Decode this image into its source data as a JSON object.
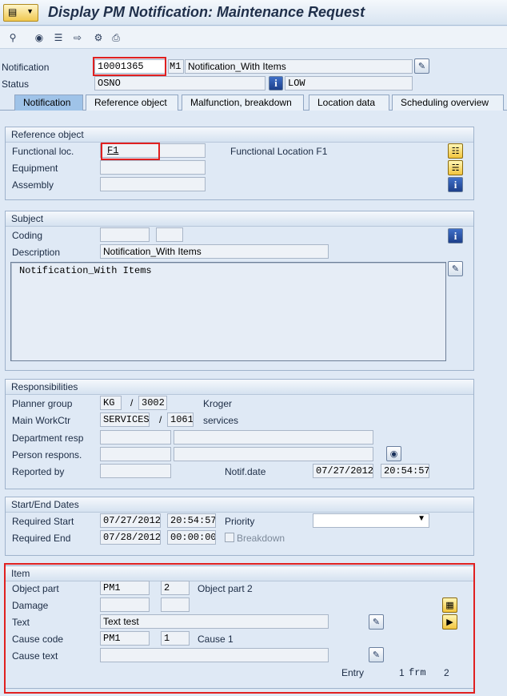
{
  "window": {
    "title": "Display PM Notification: Maintenance Request"
  },
  "header": {
    "notification_label": "Notification",
    "notification_number": "10001365",
    "notification_type": "M1",
    "notification_desc": "Notification_With Items",
    "status_label": "Status",
    "status_value": "OSNO",
    "priority_text": "LOW"
  },
  "tabs": [
    {
      "label": "Notification"
    },
    {
      "label": "Reference object"
    },
    {
      "label": "Malfunction, breakdown"
    },
    {
      "label": "Location data"
    },
    {
      "label": "Scheduling overview"
    }
  ],
  "reference_object": {
    "title": "Reference object",
    "functional_loc_label": "Functional loc.",
    "functional_loc_value": "F1",
    "functional_loc_desc": "Functional Location F1",
    "equipment_label": "Equipment",
    "assembly_label": "Assembly"
  },
  "subject": {
    "title": "Subject",
    "coding_label": "Coding",
    "description_label": "Description",
    "description_value": "Notification_With Items",
    "long_text": "Notification_With Items"
  },
  "responsibilities": {
    "title": "Responsibilities",
    "planner_group_label": "Planner group",
    "planner_group": "KG",
    "planner_plant": "3002",
    "planner_desc": "Kroger",
    "main_workctr_label": "Main WorkCtr",
    "main_workctr": "SERVICES",
    "workctr_plant": "1061",
    "workctr_desc": "services",
    "department_label": "Department resp",
    "person_label": "Person respons.",
    "reported_by_label": "Reported by",
    "notif_date_label": "Notif.date",
    "notif_date": "07/27/2012",
    "notif_time": "20:54:57"
  },
  "dates": {
    "title": "Start/End Dates",
    "required_start_label": "Required Start",
    "start_date": "07/27/2012",
    "start_time": "20:54:57",
    "required_end_label": "Required End",
    "end_date": "07/28/2012",
    "end_time": "00:00:00",
    "priority_label": "Priority",
    "breakdown_label": "Breakdown"
  },
  "item": {
    "title": "Item",
    "object_part_label": "Object part",
    "object_part": "PM1",
    "object_part_code": "2",
    "object_part_desc": "Object part 2",
    "damage_label": "Damage",
    "text_label": "Text",
    "text_value": "Text test",
    "cause_code_label": "Cause code",
    "cause_code": "PM1",
    "cause_code_num": "1",
    "cause_desc": "Cause 1",
    "cause_text_label": "Cause text",
    "entry_label": "Entry",
    "entry_current": "1",
    "entry_frm": "frm",
    "entry_total": "2"
  },
  "icons": [
    "menu-icon",
    "find-icon",
    "binoculars-icon",
    "list-icon",
    "jump-icon",
    "settings-icon",
    "print-icon",
    "hierarchy-icon",
    "structure-icon",
    "info-icon",
    "longtext-icon",
    "first-entry-icon",
    "next-entry-icon"
  ]
}
